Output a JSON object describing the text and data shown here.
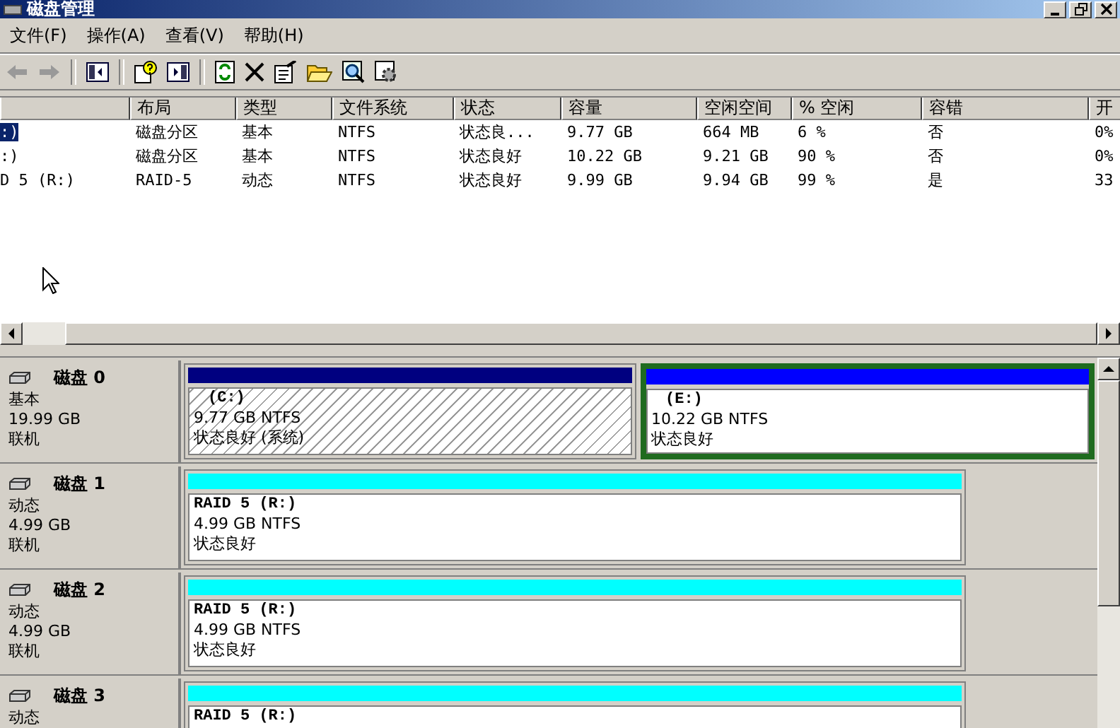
{
  "window": {
    "title": "磁盘管理"
  },
  "menu": [
    {
      "label": "文件(F)"
    },
    {
      "label": "操作(A)"
    },
    {
      "label": "查看(V)"
    },
    {
      "label": "帮助(H)"
    }
  ],
  "table": {
    "columns": [
      "",
      "布局",
      "类型",
      "文件系统",
      "状态",
      "容量",
      "空闲空间",
      "% 空闲",
      "容错",
      "开"
    ],
    "rows": [
      {
        "selected": true,
        "cells": [
          ":)",
          "磁盘分区",
          "基本",
          "NTFS",
          "状态良...",
          "9.77 GB",
          "664 MB",
          "6 %",
          "否",
          "0%"
        ]
      },
      {
        "selected": false,
        "cells": [
          ":)",
          "磁盘分区",
          "基本",
          "NTFS",
          "状态良好",
          "10.22 GB",
          "9.21 GB",
          "90 %",
          "否",
          "0%"
        ]
      },
      {
        "selected": false,
        "cells": [
          "D 5 (R:)",
          "RAID-5",
          "动态",
          "NTFS",
          "状态良好",
          "9.99 GB",
          "9.94 GB",
          "99 %",
          "是",
          "33"
        ]
      }
    ]
  },
  "disks": [
    {
      "name": "磁盘 0",
      "type": "基本",
      "size": "19.99 GB",
      "status": "联机",
      "partitions": [
        {
          "kind": "basic",
          "title": "(C:)",
          "size": "9.77 GB NTFS",
          "status": "状态良好 (系统)",
          "color": "#000080",
          "hatched": true,
          "selected": false
        },
        {
          "kind": "basic",
          "title": "(E:)",
          "size": "10.22 GB NTFS",
          "status": "状态良好",
          "color": "#0000ff",
          "hatched": false,
          "selected": true
        }
      ]
    },
    {
      "name": "磁盘 1",
      "type": "动态",
      "size": "4.99 GB",
      "status": "联机",
      "partitions": [
        {
          "kind": "raid",
          "title": "RAID 5  (R:)",
          "size": "4.99 GB NTFS",
          "status": "状态良好",
          "color": "#00ffff",
          "hatched": false,
          "selected": false
        }
      ]
    },
    {
      "name": "磁盘 2",
      "type": "动态",
      "size": "4.99 GB",
      "status": "联机",
      "partitions": [
        {
          "kind": "raid",
          "title": "RAID 5  (R:)",
          "size": "4.99 GB NTFS",
          "status": "状态良好",
          "color": "#00ffff",
          "hatched": false,
          "selected": false
        }
      ]
    },
    {
      "name": "磁盘 3",
      "type": "动态",
      "partitions": [
        {
          "kind": "raid",
          "title": "RAID 5  (R:)",
          "color": "#00ffff",
          "hatched": false,
          "selected": false
        }
      ]
    }
  ]
}
